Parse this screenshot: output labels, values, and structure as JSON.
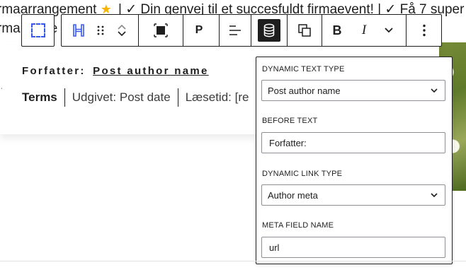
{
  "background": {
    "line1_before_star": "rmaarrangement",
    "line1_after_star": " | ✓ Din genvej til et succesfuldt firmaevent! | ✓ Få 7 super",
    "line2": "rma",
    "line2_tail": "e"
  },
  "content": {
    "author_prefix": "Forfatter:",
    "author_link": "Post author name",
    "meta_terms": "Terms",
    "meta_published": "Udgivet: Post date",
    "meta_reading": "Læsetid: [re"
  },
  "toolbar": {
    "paragraph_label": "P",
    "bold_label": "B",
    "italic_label": "I"
  },
  "popover": {
    "dynamic_text_type_label": "DYNAMIC TEXT TYPE",
    "dynamic_text_type_value": "Post author name",
    "before_text_label": "BEFORE TEXT",
    "before_text_value": "Forfatter:",
    "dynamic_link_type_label": "DYNAMIC LINK TYPE",
    "dynamic_link_type_value": "Author meta",
    "meta_field_name_label": "META FIELD NAME",
    "meta_field_name_value": "url"
  },
  "colors": {
    "accent": "#3858e9",
    "text": "#1e1e1e",
    "star": "#f5b400"
  }
}
